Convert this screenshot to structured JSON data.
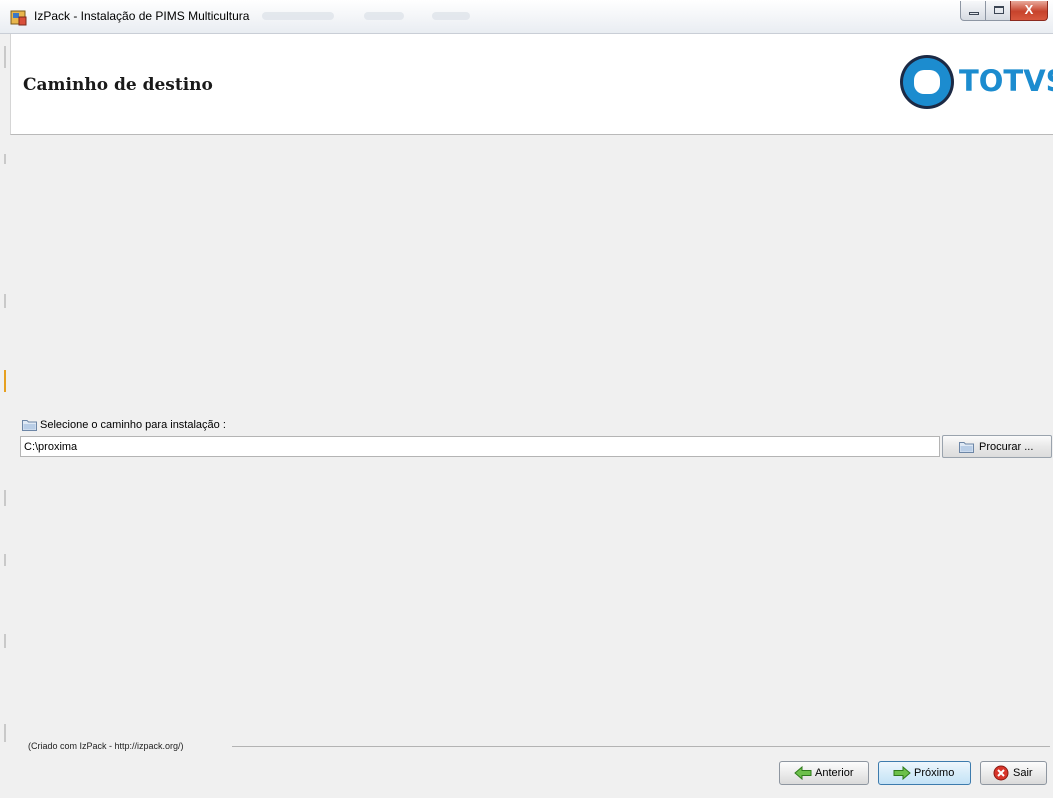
{
  "window": {
    "title": "IzPack - Instalação de PIMS Multicultura",
    "close_glyph": "X"
  },
  "header": {
    "title": "Caminho de destino",
    "logo_text": "TOTVS",
    "brand_color": "#1c8ccf"
  },
  "path_section": {
    "label": "Selecione o caminho para instalação :",
    "value": "C:\\proxima",
    "browse_label": "Procurar ..."
  },
  "footer": {
    "credit": "(Criado com IzPack - http://izpack.org/)",
    "buttons": {
      "previous": "Anterior",
      "next": "Próximo",
      "quit": "Sair"
    }
  },
  "icons": [
    "app-icon",
    "folder-icon",
    "arrow-left-icon",
    "arrow-right-icon",
    "close-circle-icon"
  ]
}
